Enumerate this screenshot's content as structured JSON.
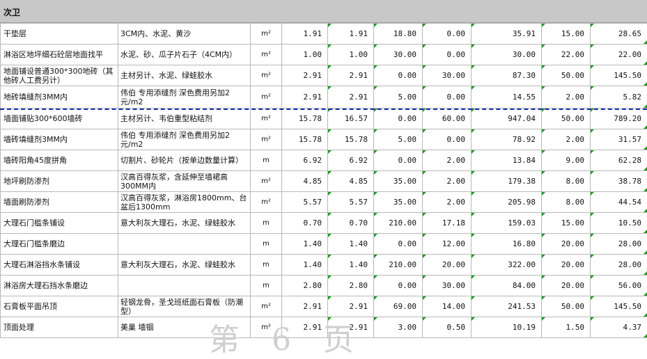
{
  "section": {
    "title": "次卫"
  },
  "rows": [
    {
      "name": "干垫层",
      "material": "3CM内、水泥、黄沙",
      "unit": "m²",
      "c1": "1.91",
      "c2": "1.91",
      "c3": "18.80",
      "c4": "0.00",
      "c5": "35.91",
      "c6": "15.00",
      "c7": "28.65"
    },
    {
      "name": "淋浴区地坪细石砼层地面找平",
      "material": "水泥、砂、瓜子片石子（4CM内）",
      "unit": "m²",
      "c1": "1.00",
      "c2": "1.00",
      "c3": "30.00",
      "c4": "0.00",
      "c5": "30.00",
      "c6": "22.00",
      "c7": "22.00"
    },
    {
      "name": "地面铺设普通300*300地砖（其他砖人工费另计）",
      "material": "主材另计、水泥、绿蛙胶水",
      "unit": "m²",
      "c1": "2.91",
      "c2": "2.91",
      "c3": "0.00",
      "c4": "30.00",
      "c5": "87.30",
      "c6": "50.00",
      "c7": "145.50"
    },
    {
      "name": "地砖填缝剂3MM内",
      "material": "伟伯 专用添缝剂  深色费用另加2元/m2",
      "unit": "m²",
      "c1": "2.91",
      "c2": "2.91",
      "c3": "5.00",
      "c4": "0.00",
      "c5": "14.55",
      "c6": "2.00",
      "c7": "5.82"
    },
    {
      "name": "墙面铺贴300*600墙砖",
      "material": "主材另计、韦伯重型粘结剂",
      "unit": "m²",
      "c1": "15.78",
      "c2": "16.57",
      "c3": "0.00",
      "c4": "60.00",
      "c5": "947.04",
      "c6": "50.00",
      "c7": "789.20"
    },
    {
      "name": "墙砖填缝剂3MM内",
      "material": "伟伯 专用添缝剂  深色费用另加2元/m2",
      "unit": "m²",
      "c1": "15.78",
      "c2": "15.78",
      "c3": "5.00",
      "c4": "0.00",
      "c5": "78.92",
      "c6": "2.00",
      "c7": "31.57"
    },
    {
      "name": "墙砖阳角45度拼角",
      "material": "切割片、砂轮片（按单边数量计算）",
      "unit": "m",
      "c1": "6.92",
      "c2": "6.92",
      "c3": "0.00",
      "c4": "2.00",
      "c5": "13.84",
      "c6": "9.00",
      "c7": "62.28"
    },
    {
      "name": "地坪刷防渗剂",
      "material": "汉高百得灰浆，含延伸至墙裙高300MM内",
      "unit": "m²",
      "c1": "4.85",
      "c2": "4.85",
      "c3": "35.00",
      "c4": "2.00",
      "c5": "179.38",
      "c6": "8.00",
      "c7": "38.78"
    },
    {
      "name": "墙面刷防渗剂",
      "material": "汉高百得灰浆，淋浴房1800mm、台盆后1300mm",
      "unit": "m²",
      "c1": "5.57",
      "c2": "5.57",
      "c3": "35.00",
      "c4": "2.00",
      "c5": "205.98",
      "c6": "8.00",
      "c7": "44.54"
    },
    {
      "name": "大理石门槛条铺设",
      "material": "意大利灰大理石，水泥、绿蛙胶水",
      "unit": "m",
      "c1": "0.70",
      "c2": "0.70",
      "c3": "210.00",
      "c4": "17.18",
      "c5": "159.03",
      "c6": "15.00",
      "c7": "10.50"
    },
    {
      "name": "大理石门槛条磨边",
      "material": "",
      "unit": "m",
      "c1": "1.40",
      "c2": "1.40",
      "c3": "0.00",
      "c4": "12.00",
      "c5": "16.80",
      "c6": "20.00",
      "c7": "28.00"
    },
    {
      "name": "大理石淋浴挡水条铺设",
      "material": "意大利灰大理石，水泥、绿蛙胶水",
      "unit": "m",
      "c1": "1.40",
      "c2": "1.40",
      "c3": "210.00",
      "c4": "20.00",
      "c5": "322.00",
      "c6": "20.00",
      "c7": "28.00"
    },
    {
      "name": "淋浴房大理石挡水条磨边",
      "material": "",
      "unit": "m",
      "c1": "2.80",
      "c2": "2.80",
      "c3": "0.00",
      "c4": "30.00",
      "c5": "84.00",
      "c6": "20.00",
      "c7": "56.00"
    },
    {
      "name": "石膏板平面吊顶",
      "material": "轻钢龙骨，圣戈班纸面石膏板（防潮型）",
      "unit": "m²",
      "c1": "2.91",
      "c2": "2.91",
      "c3": "69.00",
      "c4": "14.00",
      "c5": "241.53",
      "c6": "50.00",
      "c7": "145.50"
    },
    {
      "name": "顶面处理",
      "material": "美巢  墙锢",
      "unit": "m²",
      "c1": "2.91",
      "c2": "2.91",
      "c3": "3.00",
      "c4": "0.50",
      "c5": "10.19",
      "c6": "1.50",
      "c7": "4.37"
    }
  ],
  "watermark": "第 6 页"
}
